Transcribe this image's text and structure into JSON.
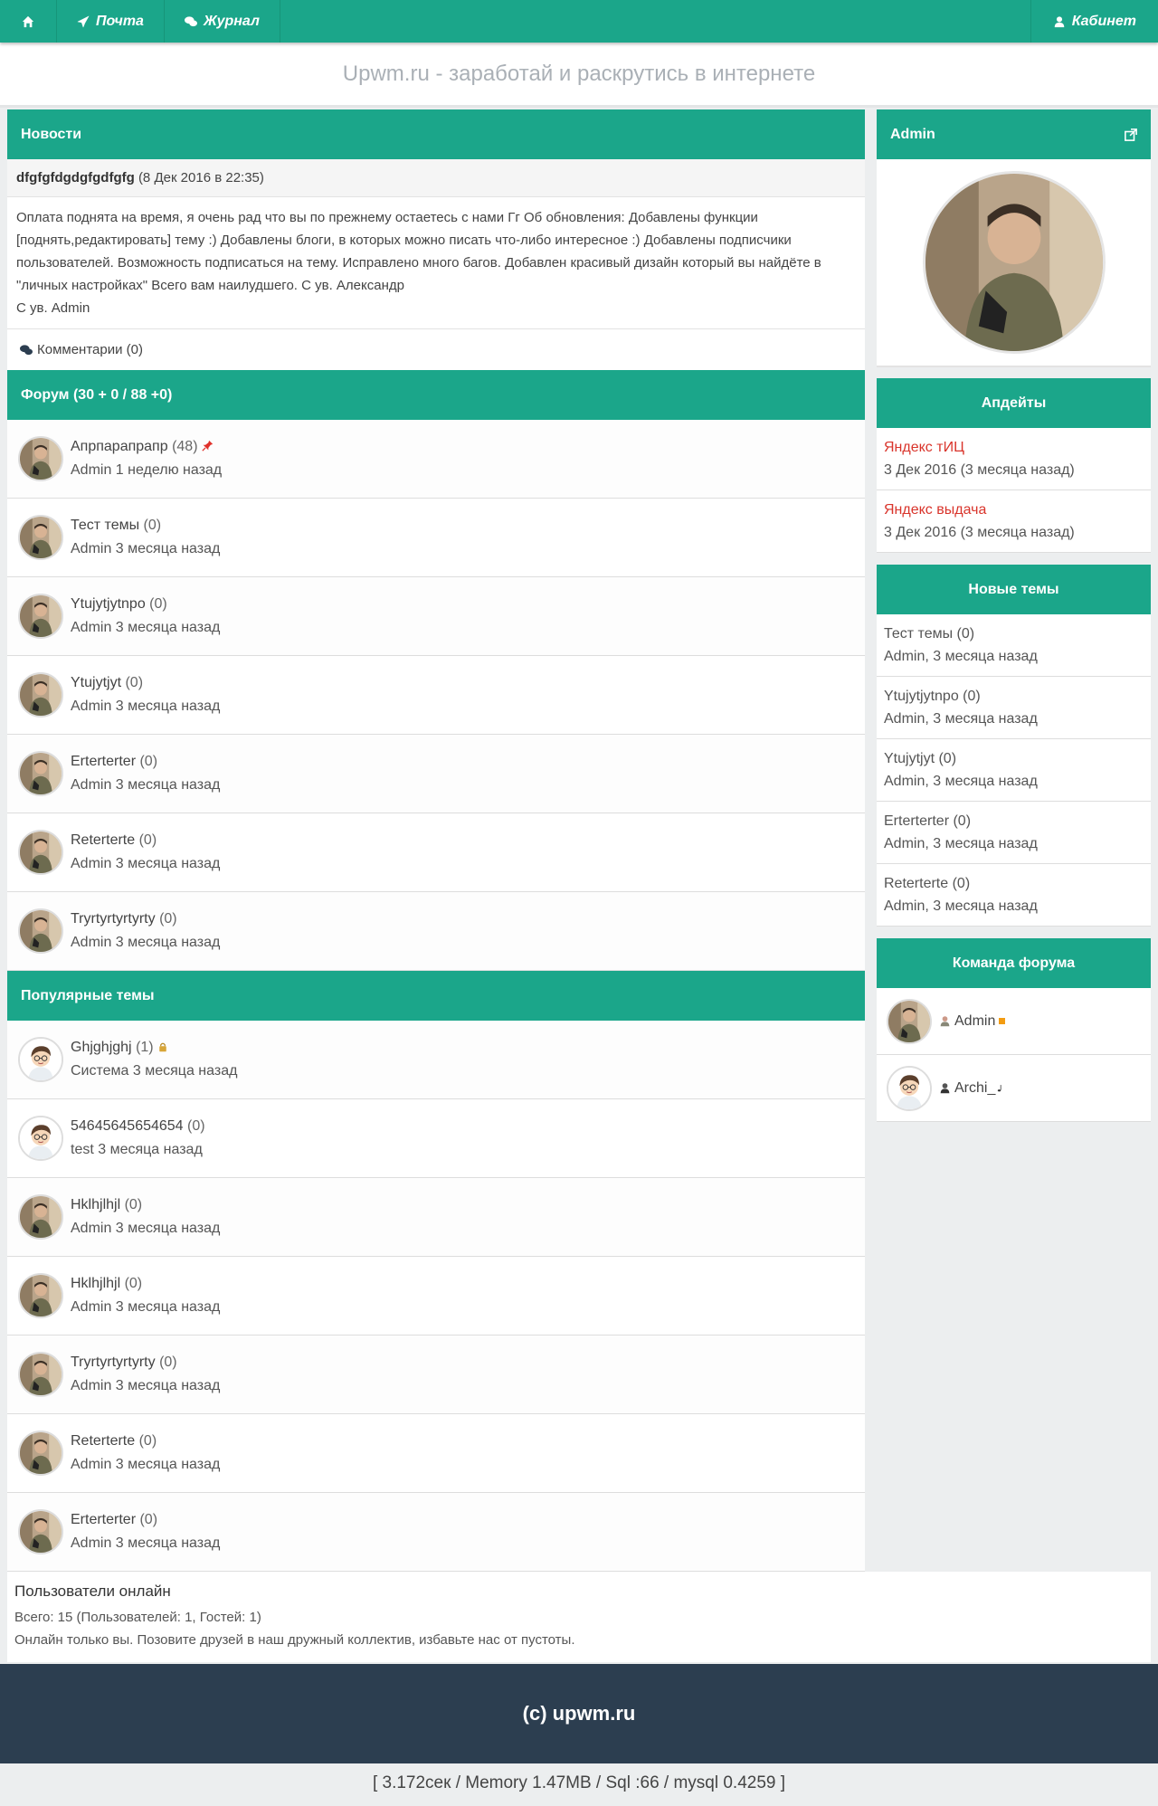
{
  "nav": {
    "home_icon": "home-icon",
    "mail_label": "Почта",
    "journal_label": "Журнал",
    "cabinet_label": "Кабинет"
  },
  "header": {
    "title": "Upwm.ru - заработай и раскрутись в интернете"
  },
  "news": {
    "heading": "Новости",
    "item_title": "dfgfgfdgdgfgdfgfg",
    "item_date": "(8 Дек 2016 в 22:35)",
    "body": "Оплата поднята на время, я очень рад что вы по прежнему остаетесь с нами Гг Об обновления: Добавлены функции [поднять,редактировать] тему :) Добавлены блоги, в которых можно писать что-либо интересное :) Добавлены подписчики пользователей. Возможность подписаться на тему. Исправлено много багов. Добавлен красивый дизайн который вы найдёте в \"личных настройках\" Всего вам наилудшего. С ув. Александр",
    "signature": "С ув. Admin",
    "comments_label": "Комментарии (0)"
  },
  "forum": {
    "heading": "Форум (30 + 0 / 88 +0)",
    "topics": [
      {
        "title": "Апрпарапрапр",
        "count": "(48)",
        "pinned": true,
        "meta": "Admin 1 неделю назад"
      },
      {
        "title": "Тест темы",
        "count": "(0)",
        "meta": "Admin 3 месяца назад"
      },
      {
        "title": "Ytujytjytnpo",
        "count": "(0)",
        "meta": "Admin 3 месяца назад"
      },
      {
        "title": "Ytujytjyt",
        "count": "(0)",
        "meta": "Admin 3 месяца назад"
      },
      {
        "title": "Erterterter",
        "count": "(0)",
        "meta": "Admin 3 месяца назад"
      },
      {
        "title": "Reterterte",
        "count": "(0)",
        "meta": "Admin 3 месяца назад"
      },
      {
        "title": "Tryrtyrtyrtyrty",
        "count": "(0)",
        "meta": "Admin 3 месяца назад"
      }
    ]
  },
  "popular": {
    "heading": "Популярные темы",
    "topics": [
      {
        "title": "Ghjghjghj",
        "count": "(1)",
        "meta": "Система 3 месяца назад"
      },
      {
        "title": "54645645654654",
        "count": "(0)",
        "meta": "test 3 месяца назад"
      },
      {
        "title": "Hklhjlhjl",
        "count": "(0)",
        "meta": "Admin 3 месяца назад"
      },
      {
        "title": "Hklhjlhjl",
        "count": "(0)",
        "meta": "Admin 3 месяца назад"
      },
      {
        "title": "Tryrtyrtyrtyrty",
        "count": "(0)",
        "meta": "Admin 3 месяца назад"
      },
      {
        "title": "Reterterte",
        "count": "(0)",
        "meta": "Admin 3 месяца назад"
      },
      {
        "title": "Erterterter",
        "count": "(0)",
        "meta": "Admin 3 месяца назад"
      }
    ]
  },
  "online": {
    "heading": "Пользователи онлайн",
    "stats": "Всего: 15 (Пользователей: 1, Гостей: 1)",
    "note": "Онлайн только вы. Позовите друзей в наш дружный коллектив, избавьте нас от пустоты."
  },
  "footer": {
    "copyright": "(c) upwm.ru"
  },
  "stats_line": "[ 3.172сек / Memory 1.47MB / Sql :66 / mysql 0.4259 ]",
  "sidebar": {
    "user_heading": "Admin",
    "updates_heading": "Апдейты",
    "updates": [
      {
        "label": "Яндекс тИЦ",
        "date": "3 Дек 2016 (3 месяца назад)"
      },
      {
        "label": "Яндекс выдача",
        "date": "3 Дек 2016 (3 месяца назад)"
      }
    ],
    "new_topics_heading": "Новые темы",
    "new_topics": [
      {
        "title": "Тест темы",
        "count": "(0)",
        "meta": "Admin, 3 месяца назад"
      },
      {
        "title": "Ytujytjytnpo",
        "count": "(0)",
        "meta": "Admin, 3 месяца назад"
      },
      {
        "title": "Ytujytjyt",
        "count": "(0)",
        "meta": "Admin, 3 месяца назад"
      },
      {
        "title": "Erterterter",
        "count": "(0)",
        "meta": "Admin, 3 месяца назад"
      },
      {
        "title": "Reterterte",
        "count": "(0)",
        "meta": "Admin, 3 месяца назад"
      }
    ],
    "team_heading": "Команда форума",
    "team": [
      {
        "name": "Admin"
      },
      {
        "name": "Archi_"
      }
    ]
  },
  "colors": {
    "accent": "#1ba68a",
    "footer": "#2c3e50",
    "red_label": "#d9342b"
  }
}
